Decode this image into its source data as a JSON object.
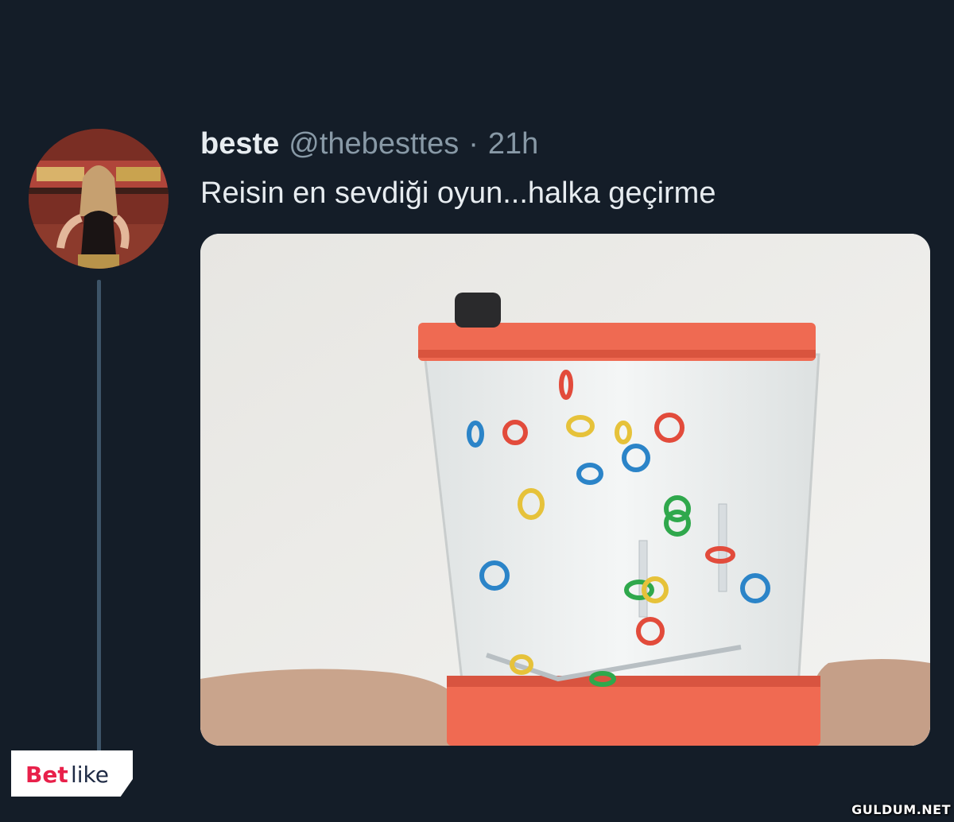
{
  "tweet": {
    "display_name": "beste",
    "handle": "@thebesttes",
    "separator": "·",
    "time": "21h",
    "text": "Reisin en sevdiği oyun...halka geçirme",
    "media": {
      "description_icon": "water-ring-toss-game-photo"
    }
  },
  "branding": {
    "logo_text": "Betlike",
    "logo_color": "#e8204a",
    "watermark": "GULDUM.NET"
  },
  "colors": {
    "background": "#141d28",
    "text_primary": "#e7ecf0",
    "text_secondary": "#8899a6",
    "thread_line": "#3d5468"
  }
}
